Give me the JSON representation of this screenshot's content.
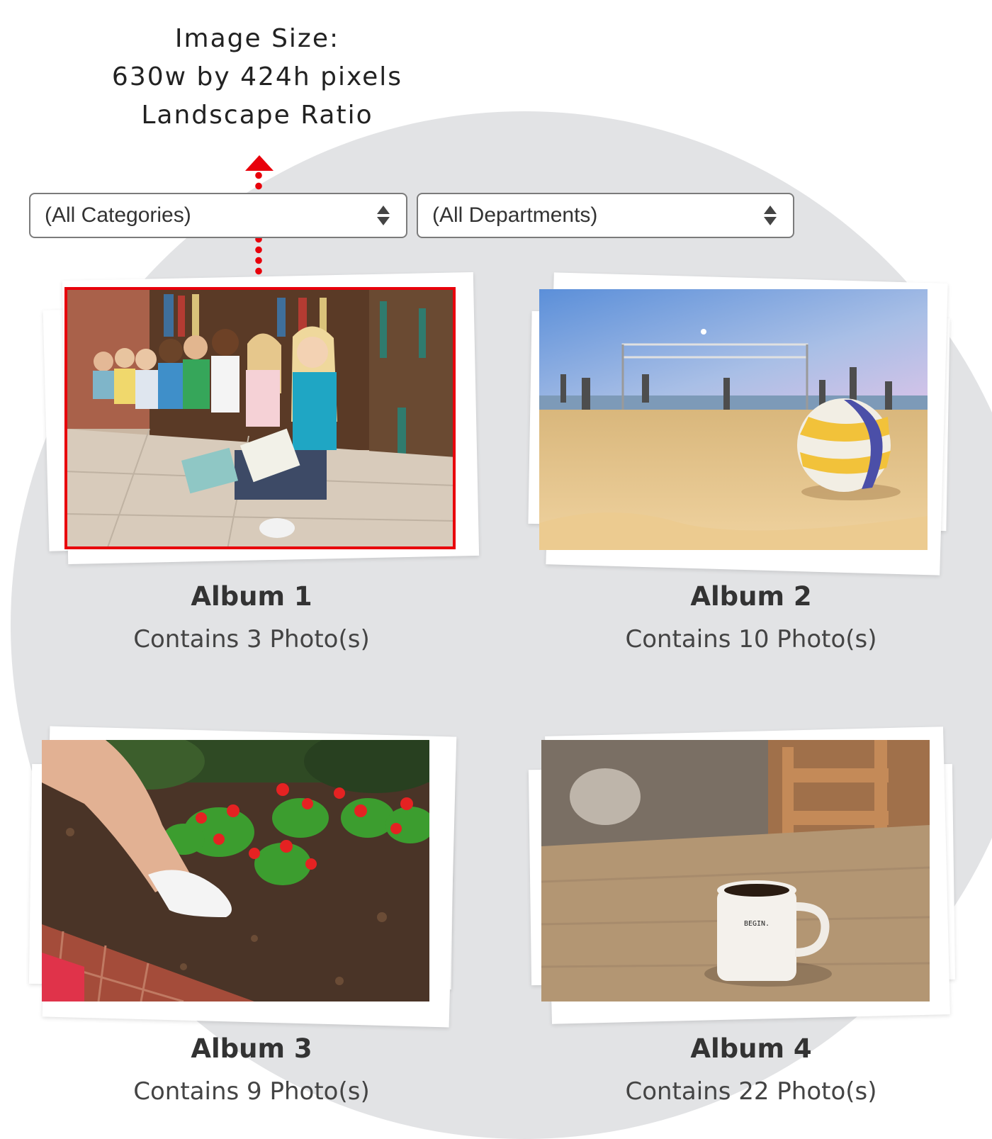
{
  "annotation": {
    "line1": "Image Size:",
    "line2": "630w by 424h pixels",
    "line3": "Landscape Ratio",
    "arrow_color": "#e8000b"
  },
  "filters": {
    "category": "(All Categories)",
    "department": "(All Departments)"
  },
  "albums": [
    {
      "title": "Album 1",
      "count": "Contains 3 Photo(s)",
      "image": "children-reading-in-library",
      "highlighted": true
    },
    {
      "title": "Album 2",
      "count": "Contains 10 Photo(s)",
      "image": "beach-volleyball"
    },
    {
      "title": "Album 3",
      "count": "Contains 9 Photo(s)",
      "image": "planting-red-flowers"
    },
    {
      "title": "Album 4",
      "count": "Contains 22 Photo(s)",
      "image": "coffee-mug-on-table",
      "mug_text": "BEGIN."
    }
  ],
  "colors": {
    "background_circle": "#e2e3e5",
    "highlight": "#e8000b"
  }
}
